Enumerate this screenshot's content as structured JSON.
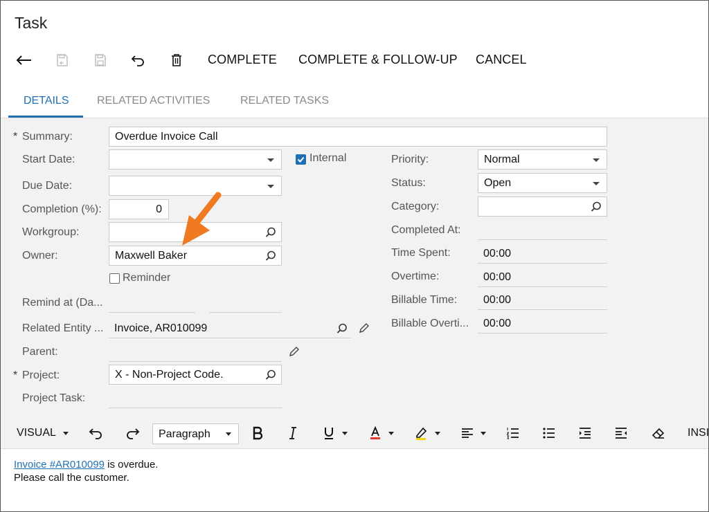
{
  "window": {
    "title": "Task"
  },
  "toolbar": {
    "complete_label": "COMPLETE",
    "complete_followup_label": "COMPLETE & FOLLOW-UP",
    "cancel_label": "CANCEL"
  },
  "tabs": [
    {
      "label": "DETAILS",
      "active": true
    },
    {
      "label": "RELATED ACTIVITIES",
      "active": false
    },
    {
      "label": "RELATED TASKS",
      "active": false
    }
  ],
  "form": {
    "required_mark": "*",
    "summary": {
      "label": "Summary:",
      "value": "Overdue Invoice Call"
    },
    "start_date": {
      "label": "Start Date:",
      "value": ""
    },
    "due_date": {
      "label": "Due Date:",
      "value": ""
    },
    "completion": {
      "label": "Completion (%):",
      "value": "0"
    },
    "workgroup": {
      "label": "Workgroup:",
      "value": ""
    },
    "owner": {
      "label": "Owner:",
      "value": "Maxwell Baker"
    },
    "reminder": {
      "label": "Reminder",
      "checked": false
    },
    "remind_at": {
      "label": "Remind at (Da..."
    },
    "related_entity": {
      "label": "Related Entity ...",
      "value": "Invoice, AR010099"
    },
    "parent": {
      "label": "Parent:",
      "value": ""
    },
    "project": {
      "label": "Project:",
      "value": "X - Non-Project Code."
    },
    "project_task": {
      "label": "Project Task:",
      "value": ""
    },
    "internal": {
      "label": "Internal",
      "checked": true
    },
    "priority": {
      "label": "Priority:",
      "value": "Normal"
    },
    "status": {
      "label": "Status:",
      "value": "Open"
    },
    "category": {
      "label": "Category:",
      "value": ""
    },
    "completed_at": {
      "label": "Completed At:",
      "value": ""
    },
    "time_spent": {
      "label": "Time Spent:",
      "value": "00:00"
    },
    "overtime": {
      "label": "Overtime:",
      "value": "00:00"
    },
    "billable_time": {
      "label": "Billable Time:",
      "value": "00:00"
    },
    "billable_overtime": {
      "label": "Billable Overti...",
      "value": "00:00"
    }
  },
  "editor": {
    "mode_label": "VISUAL",
    "paragraph_label": "Paragraph",
    "insert_label": "INSI",
    "content": {
      "link_text": "Invoice #AR010099",
      "line1_rest": " is overdue.",
      "line2": "Please call the customer."
    }
  },
  "colors": {
    "accent": "#1f6fb5",
    "annotation_arrow": "#f07a22",
    "form_background": "#f2f2f2"
  }
}
